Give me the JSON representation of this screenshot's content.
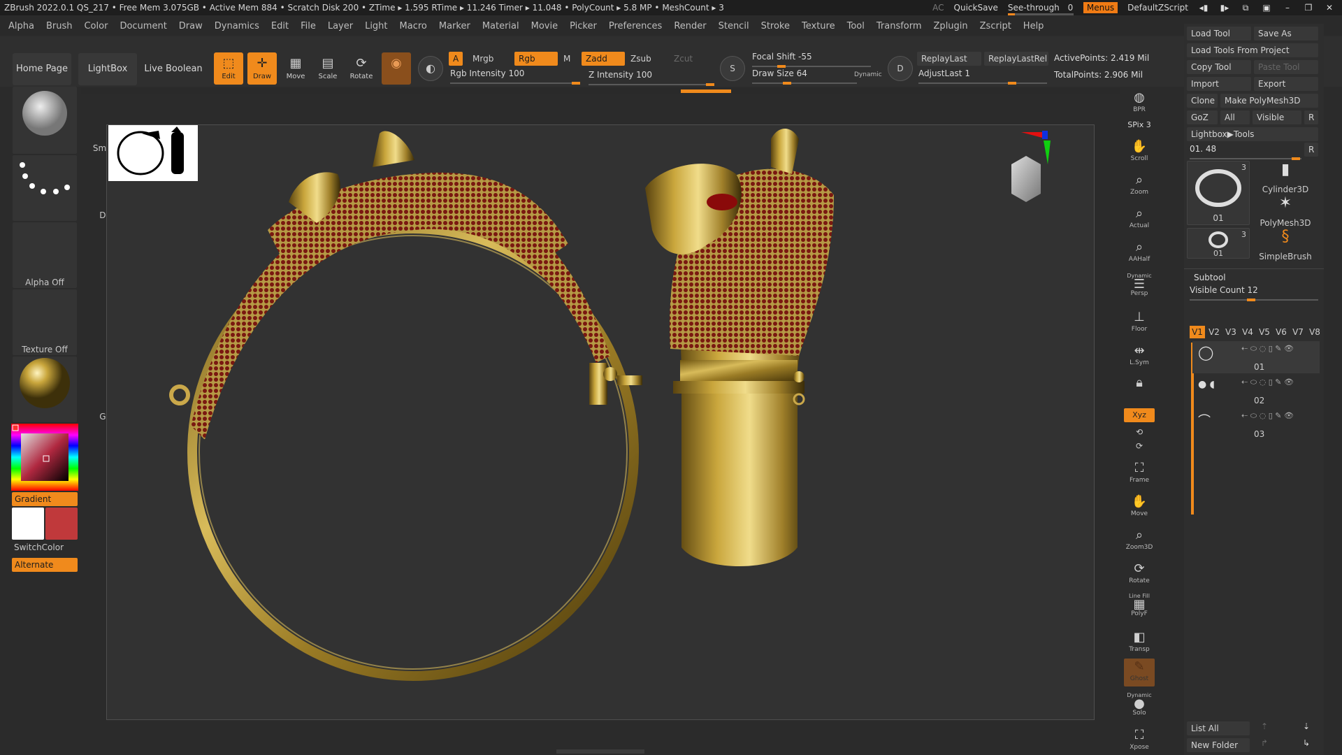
{
  "titlebar": {
    "info": "ZBrush 2022.0.1   QS_217   • Free Mem 3.075GB • Active Mem 884 • Scratch Disk 200 •  ZTime ▸ 1.595 RTime ▸ 11.246 Timer ▸ 11.048  • PolyCount ▸ 5.8 MP   • MeshCount ▸ 3",
    "ac": "AC",
    "quicksave": "QuickSave",
    "seethrough_label": "See-through",
    "seethrough_value": "0",
    "menus": "Menus",
    "script": "DefaultZScript"
  },
  "menubar": [
    "Alpha",
    "Brush",
    "Color",
    "Document",
    "Draw",
    "Dynamics",
    "Edit",
    "File",
    "Layer",
    "Light",
    "Macro",
    "Marker",
    "Material",
    "Movie",
    "Picker",
    "Preferences",
    "Render",
    "Stencil",
    "Stroke",
    "Texture",
    "Tool",
    "Transform",
    "Zplugin",
    "Zscript",
    "Help"
  ],
  "toolbar": {
    "home_page": "Home Page",
    "lightbox": "LightBox",
    "live_boolean": "Live Boolean",
    "edit": "Edit",
    "draw": "Draw",
    "move": "Move",
    "scale": "Scale",
    "rotate": "Rotate",
    "a": "A",
    "mrgb": "Mrgb",
    "rgb": "Rgb",
    "m": "M",
    "zadd": "Zadd",
    "zsub": "Zsub",
    "zcut": "Zcut",
    "rgb_intensity_label": "Rgb Intensity",
    "rgb_intensity_value": "100",
    "z_intensity_label": "Z Intensity",
    "z_intensity_value": "100",
    "focal_shift_label": "Focal Shift",
    "focal_shift_value": "-55",
    "draw_size_label": "Draw Size",
    "draw_size_value": "64",
    "dynamic": "Dynamic",
    "replay_last": "ReplayLast",
    "replay_last_rel": "ReplayLastRel",
    "adjust_last_label": "AdjustLast",
    "adjust_last_value": "1",
    "active_points": "ActivePoints: 2.419 Mil",
    "total_points": "TotalPoints: 2.906 Mil",
    "s_key": "S",
    "d_key": "D"
  },
  "leftshelf": {
    "brush": "Smooth",
    "stroke": "Dots",
    "alpha": "Alpha Off",
    "texture": "Texture Off",
    "material": "Gold",
    "gradient": "Gradient",
    "switchcolor": "SwitchColor",
    "alternate": "Alternate",
    "main_color": "#ffffff",
    "secondary_color": "#c0393b"
  },
  "rightshelf": [
    {
      "label": "BPR",
      "icon": "bpr-icon"
    },
    {
      "label": "SPix 3",
      "icon": "spix-icon"
    },
    {
      "label": "Scroll",
      "icon": "scroll-icon"
    },
    {
      "label": "Zoom",
      "icon": "zoom-icon"
    },
    {
      "label": "Actual",
      "icon": "actual-icon"
    },
    {
      "label": "AAHalf",
      "icon": "aahalf-icon"
    },
    {
      "label": "Persp",
      "icon": "persp-icon",
      "sub": "Dynamic"
    },
    {
      "label": "Floor",
      "icon": "floor-icon"
    },
    {
      "label": "L.Sym",
      "icon": "lsym-icon"
    },
    {
      "label": "",
      "icon": "lock-icon"
    },
    {
      "label": "Xyz",
      "icon": "xyz-icon"
    },
    {
      "label": "Frame",
      "icon": "frame-icon"
    },
    {
      "label": "Move",
      "icon": "move-icon"
    },
    {
      "label": "Zoom3D",
      "icon": "zoom3d-icon"
    },
    {
      "label": "Rotate",
      "icon": "rotate-icon"
    },
    {
      "label": "PolyF",
      "icon": "polyf-icon",
      "sub": "Line Fill"
    },
    {
      "label": "Transp",
      "icon": "transp-icon"
    },
    {
      "label": "Ghost",
      "icon": "ghost-icon"
    },
    {
      "label": "Solo",
      "icon": "solo-icon",
      "sub": "Dynamic"
    },
    {
      "label": "Xpose",
      "icon": "xpose-icon"
    }
  ],
  "toolpanel": {
    "load_tool": "Load Tool",
    "save_as": "Save As",
    "load_from_project": "Load Tools From Project",
    "copy_tool": "Copy Tool",
    "paste_tool": "Paste Tool",
    "import": "Import",
    "export": "Export",
    "clone": "Clone",
    "make_polymesh": "Make PolyMesh3D",
    "goz": "GoZ",
    "all": "All",
    "visible": "Visible",
    "r": "R",
    "lightbox_tools": "Lightbox▶Tools",
    "tool_slider": "01. 48",
    "thumbs": [
      {
        "name": "01",
        "count": "3"
      },
      {
        "name": "Cylinder3D"
      },
      {
        "name": "PolyMesh3D"
      },
      {
        "name": "01",
        "count": "3"
      },
      {
        "name": "SimpleBrush"
      }
    ],
    "subtool_title": "Subtool",
    "visible_count_label": "Visible Count",
    "visible_count_value": "12",
    "vtabs": [
      "V1",
      "V2",
      "V3",
      "V4",
      "V5",
      "V6",
      "V7",
      "V8"
    ],
    "subtools": [
      "01",
      "02",
      "03"
    ],
    "list_all": "List All",
    "new_folder": "New Folder"
  },
  "colors": {
    "accent": "#f08a1c",
    "gold": "#b89a35",
    "ruby": "#8a1c14"
  }
}
